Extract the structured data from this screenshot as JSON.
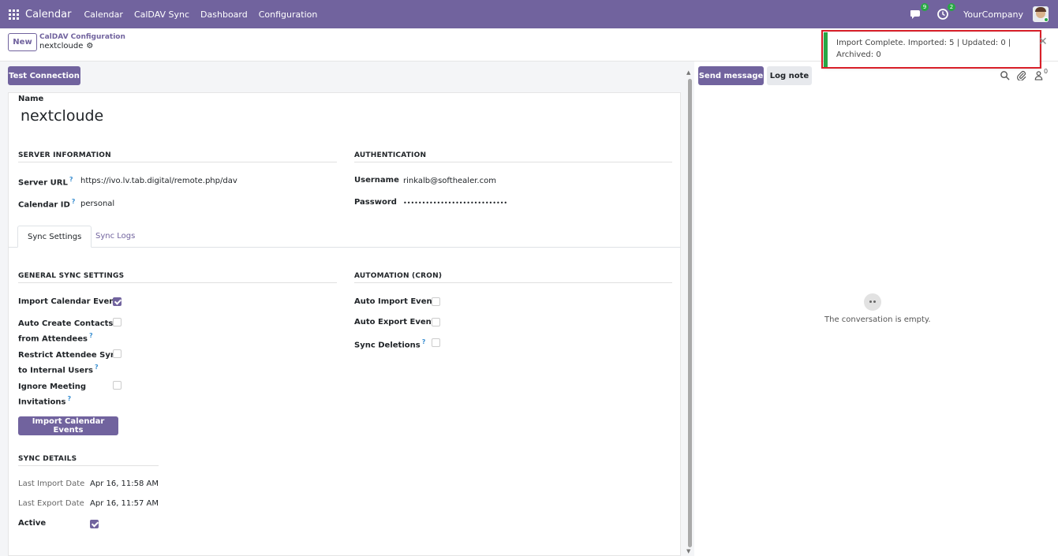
{
  "navbar": {
    "brand": "Calendar",
    "menu": [
      "Calendar",
      "CalDAV Sync",
      "Dashboard",
      "Configuration"
    ],
    "messages_count": "9",
    "activities_count": "2",
    "company": "YourCompany"
  },
  "control": {
    "new_label": "New",
    "breadcrumb": "CalDAV Configuration",
    "record_name": "nextcloude"
  },
  "toast": {
    "line1": "Import Complete. Imported: 5 | Updated: 0 |",
    "line2": "Archived: 0",
    "accent": "#28a745"
  },
  "form": {
    "test_connection_label": "Test Connection",
    "name_label": "Name",
    "name_value": "nextcloude",
    "server_section": "SERVER INFORMATION",
    "server_url_label": "Server URL",
    "server_url_value": "https://ivo.lv.tab.digital/remote.php/dav",
    "calendar_id_label": "Calendar ID",
    "calendar_id_value": "personal",
    "auth_section": "AUTHENTICATION",
    "username_label": "Username",
    "username_value": "rinkalb@softhealer.com",
    "password_label": "Password",
    "password_value": "••••••••••••••••••••••••••••",
    "tabs": [
      "Sync Settings",
      "Sync Logs"
    ],
    "general_section": "GENERAL SYNC SETTINGS",
    "import_event_label": "Import Calendar Event",
    "import_event_checked": true,
    "auto_contacts_label_1": "Auto Create Contacts",
    "auto_contacts_label_2": "from Attendees",
    "auto_contacts_checked": false,
    "restrict_label_1": "Restrict Attendee Sync",
    "restrict_label_2": "to Internal Users",
    "restrict_checked": false,
    "ignore_label_1": "Ignore Meeting",
    "ignore_label_2": "Invitations",
    "ignore_checked": false,
    "import_button_label": "Import Calendar Events",
    "automation_section": "AUTOMATION (CRON)",
    "auto_import_label": "Auto Import Event",
    "auto_export_label": "Auto Export Event",
    "sync_deletions_label": "Sync Deletions",
    "sync_details_section": "SYNC DETAILS",
    "last_import_label": "Last Import Date",
    "last_import_value": "Apr 16, 11:58 AM",
    "last_export_label": "Last Export Date",
    "last_export_value": "Apr 16, 11:57 AM",
    "active_label": "Active",
    "active_checked": true
  },
  "chatter": {
    "send_message_label": "Send message",
    "log_note_label": "Log note",
    "followers_count": "0",
    "empty_text": "The conversation is empty."
  },
  "colors": {
    "brand": "#71639e",
    "highlight": "#d9202a"
  }
}
